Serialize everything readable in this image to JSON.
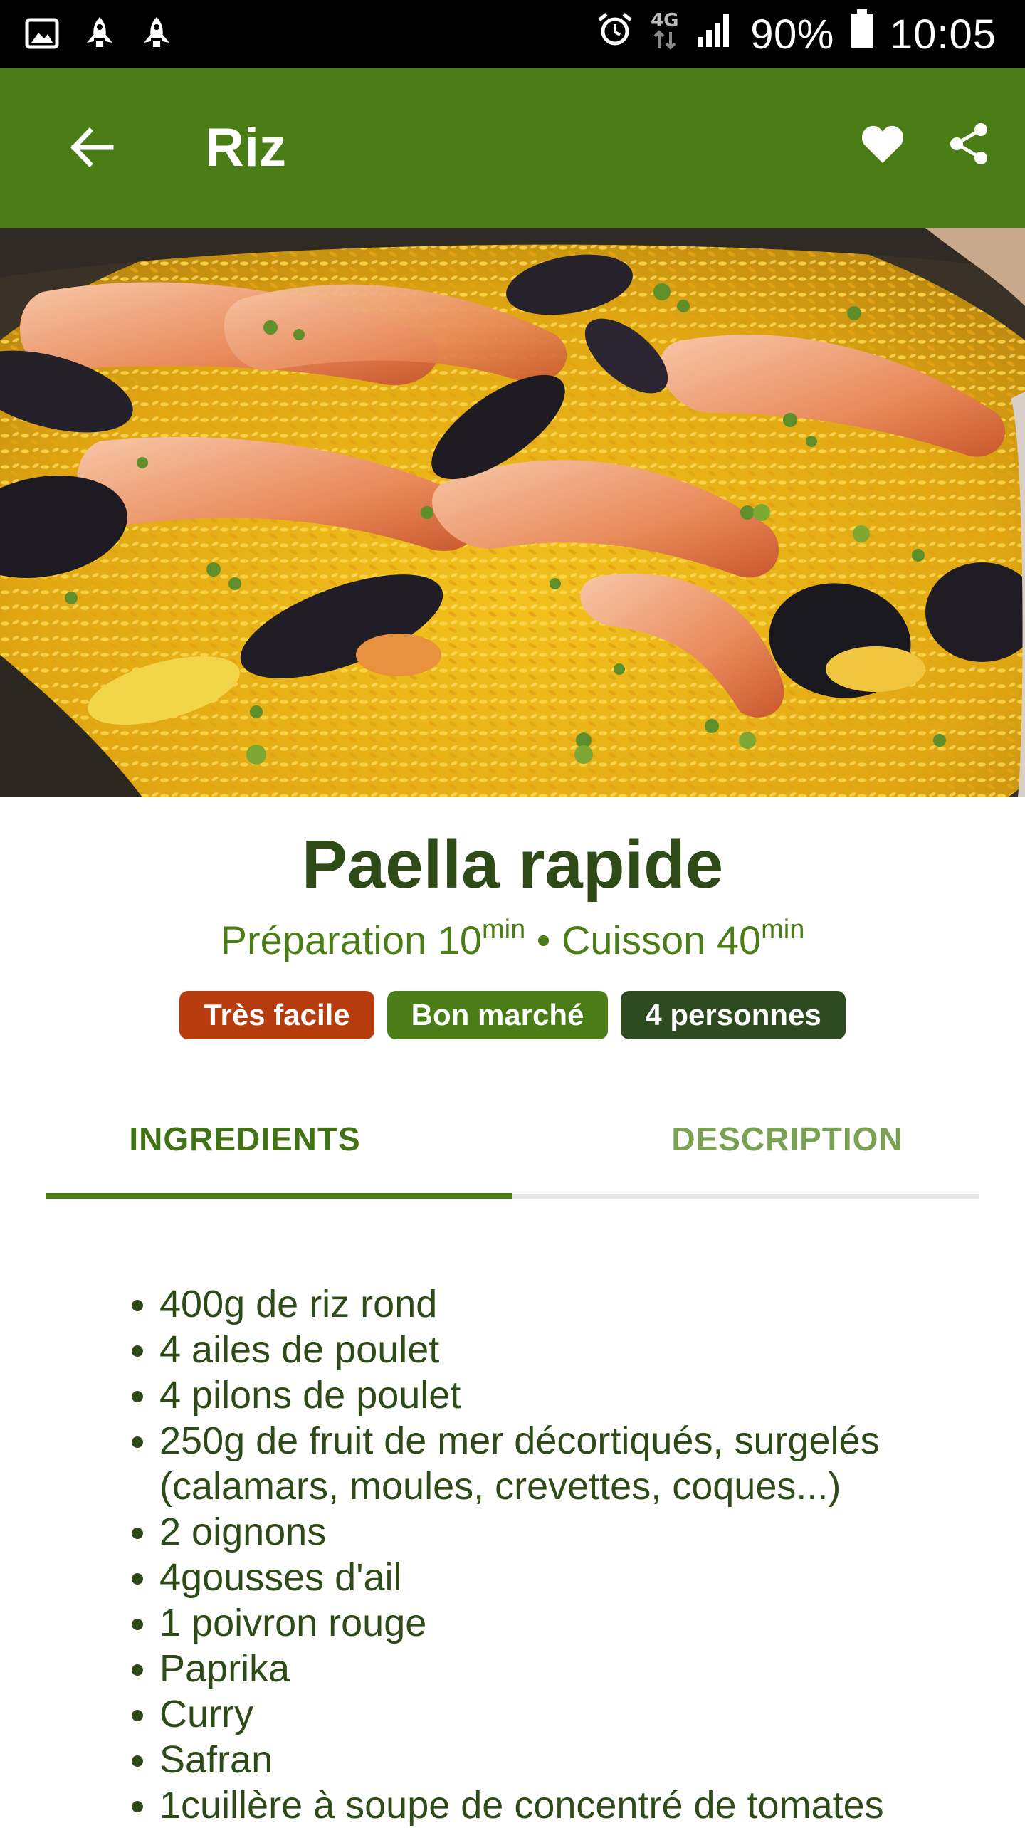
{
  "status_bar": {
    "battery_percent": "90%",
    "time": "10:05",
    "network": "4G"
  },
  "app_bar": {
    "title": "Riz"
  },
  "recipe": {
    "title": "Paella rapide",
    "prep_label": "Préparation 10",
    "prep_unit": "min",
    "separator": " • ",
    "cook_label": "Cuisson 40",
    "cook_unit": "min",
    "badges": {
      "difficulty": "Très facile",
      "cost": "Bon marché",
      "servings": "4 personnes"
    }
  },
  "tabs": {
    "ingredients": "INGREDIENTS",
    "description": "DESCRIPTION",
    "active": "ingredients"
  },
  "ingredients": [
    "400g de riz rond",
    "4 ailes de poulet",
    "4 pilons de poulet",
    "250g de fruit de mer décortiqués, surgelés (calamars, moules, crevettes, coques...)",
    "2 oignons",
    "4gousses d'ail",
    "1 poivron rouge",
    "Paprika",
    "Curry",
    "Safran",
    "1cuillère à soupe de concentré de tomates"
  ],
  "colors": {
    "app_bar": "#4b7d17",
    "title_text": "#2e4a17",
    "difficulty_badge": "#b63c0e",
    "cost_badge": "#4b7d17",
    "servings_badge": "#2e4a21"
  },
  "icons": {
    "status_left": [
      "gallery-icon",
      "rocket-icon",
      "rocket-icon"
    ],
    "status_right": [
      "alarm-icon",
      "network-4g-icon",
      "signal-icon",
      "battery-icon"
    ],
    "app_bar": [
      "back-arrow-icon",
      "heart-icon",
      "share-icon"
    ]
  }
}
